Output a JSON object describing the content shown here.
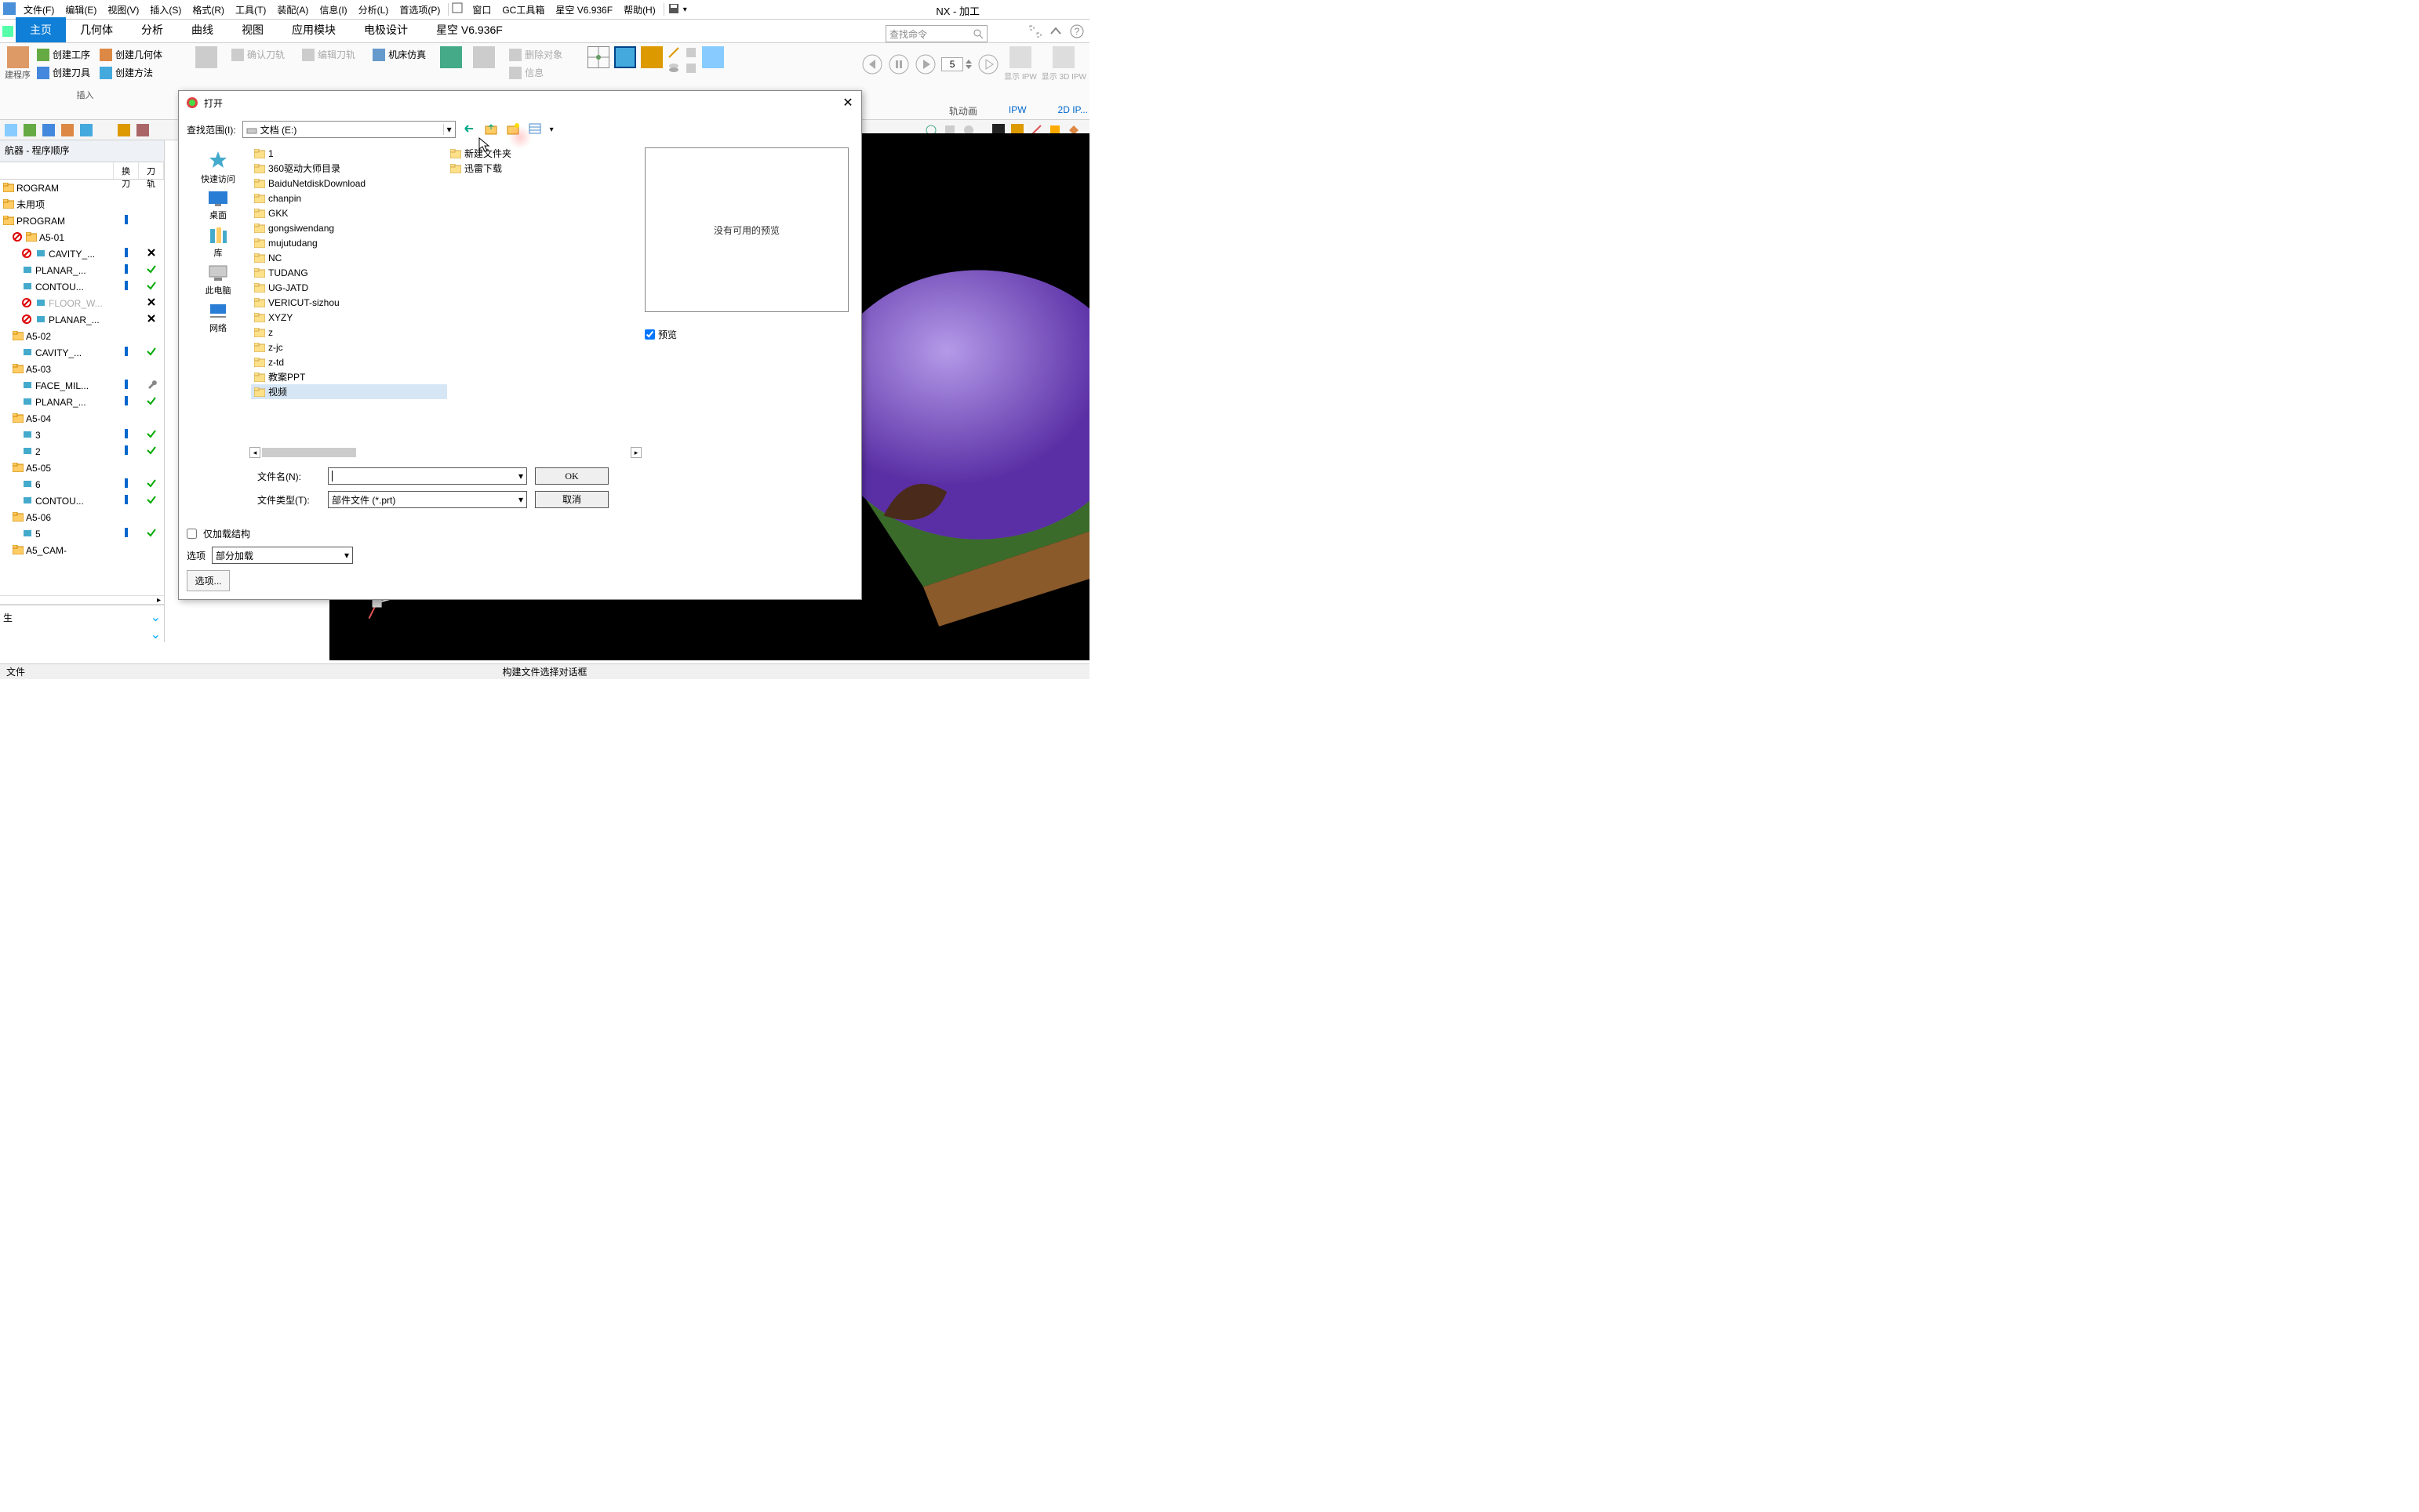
{
  "app_title": "NX - 加工",
  "menu": {
    "file": "文件(F)",
    "edit": "编辑(E)",
    "view": "视图(V)",
    "insert": "插入(S)",
    "format": "格式(R)",
    "tools": "工具(T)",
    "assemble": "装配(A)",
    "info": "信息(I)",
    "analyze": "分析(L)",
    "prefs": "首选项(P)",
    "window": "窗口",
    "gc": "GC工具箱",
    "xingkong": "星空 V6.936F",
    "help": "帮助(H)"
  },
  "tabs": {
    "home": "主页",
    "geom": "几何体",
    "analyze": "分析",
    "curve": "曲线",
    "view": "视图",
    "appmod": "应用模块",
    "elec": "电极设计",
    "xingkong": "星空 V6.936F"
  },
  "search_placeholder": "查找命令",
  "ribbon": {
    "create_op": "创建工序",
    "create_geom": "创建几何体",
    "create_tool": "创建刀具",
    "create_method": "创建方法",
    "insert_group": "插入",
    "build_program": "建程序",
    "confirm_path": "确认刀轨",
    "edit_path": "编辑刀轨",
    "machine_sim": "机床仿真",
    "delete_obj": "删除对象",
    "info": "信息",
    "show_ipw": "显示 IPW",
    "show_3d_ipw": "显示 3D IPW",
    "anim_group": "轨动画",
    "ipw_label": "IPW",
    "ipw_2d": "2D IP...",
    "spin_value": "5"
  },
  "nav": {
    "title": "航器 - 程序顺序",
    "col_tool": "换刀",
    "col_path": "刀轨"
  },
  "tree": [
    {
      "label": "ROGRAM",
      "level": 0,
      "type": "root"
    },
    {
      "label": "未用项",
      "level": 0,
      "type": "group"
    },
    {
      "label": "PROGRAM",
      "level": 0,
      "type": "program",
      "tool": "b"
    },
    {
      "label": "A5-01",
      "level": 1,
      "type": "op",
      "blocked": true
    },
    {
      "label": "CAVITY_...",
      "level": 2,
      "type": "sub",
      "blocked": true,
      "tool": "b",
      "path": "x"
    },
    {
      "label": "PLANAR_...",
      "level": 2,
      "type": "sub",
      "tool": "b",
      "path": "ok"
    },
    {
      "label": "CONTOU...",
      "level": 2,
      "type": "sub",
      "tool": "b",
      "path": "ok"
    },
    {
      "label": "FLOOR_W...",
      "level": 2,
      "type": "sub",
      "blocked": true,
      "gray": true,
      "tool": "",
      "path": "x"
    },
    {
      "label": "PLANAR_...",
      "level": 2,
      "type": "sub",
      "blocked": true,
      "tool": "",
      "path": "x"
    },
    {
      "label": "A5-02",
      "level": 1,
      "type": "op"
    },
    {
      "label": "CAVITY_...",
      "level": 2,
      "type": "sub",
      "tool": "b",
      "path": "ok"
    },
    {
      "label": "A5-03",
      "level": 1,
      "type": "op"
    },
    {
      "label": "FACE_MIL...",
      "level": 2,
      "type": "sub",
      "tool": "b",
      "path": "wrench"
    },
    {
      "label": "PLANAR_...",
      "level": 2,
      "type": "sub",
      "tool": "b",
      "path": "ok"
    },
    {
      "label": "A5-04",
      "level": 1,
      "type": "op"
    },
    {
      "label": "3",
      "level": 2,
      "type": "sub",
      "tool": "b",
      "path": "ok"
    },
    {
      "label": "2",
      "level": 2,
      "type": "sub",
      "tool": "b",
      "path": "ok"
    },
    {
      "label": "A5-05",
      "level": 1,
      "type": "op"
    },
    {
      "label": "6",
      "level": 2,
      "type": "sub",
      "tool": "b",
      "path": "ok"
    },
    {
      "label": "CONTOU...",
      "level": 2,
      "type": "sub",
      "tool": "b",
      "path": "ok"
    },
    {
      "label": "A5-06",
      "level": 1,
      "type": "op"
    },
    {
      "label": "5",
      "level": 2,
      "type": "sub",
      "tool": "b",
      "path": "ok"
    },
    {
      "label": "A5_CAM-",
      "level": 1,
      "type": "op"
    }
  ],
  "left_bottom": {
    "row1": "生"
  },
  "dialog": {
    "title": "打开",
    "lookin_label": "查找范围(I):",
    "lookin_value": "文档 (E:)",
    "places": {
      "quick": "快速访问",
      "desktop": "桌面",
      "libs": "库",
      "pc": "此电脑",
      "network": "网络"
    },
    "files": [
      "1",
      "360驱动大师目录",
      "BaiduNetdiskDownload",
      "chanpin",
      "GKK",
      "gongsiwendang",
      "mujutudang",
      "NC",
      "TUDANG",
      "UG-JATD",
      "VERICUT-sizhou",
      "XYZY",
      "z",
      "z-jc",
      "z-td",
      "教案PPT",
      "视频",
      "新建文件夹"
    ],
    "files_col2": [
      "迅雷下载"
    ],
    "selected": "视频",
    "preview_text": "没有可用的预览",
    "preview_label": "预览",
    "filename_label": "文件名(N):",
    "filename_value": "",
    "filetype_label": "文件类型(T):",
    "filetype_value": "部件文件 (*.prt)",
    "ok": "OK",
    "cancel": "取消",
    "load_struct": "仅加载结构",
    "options_label": "选项",
    "load_mode": "部分加载",
    "options_btn": "选项..."
  },
  "status": {
    "left": "文件",
    "center": "构建文件选择对话框"
  }
}
